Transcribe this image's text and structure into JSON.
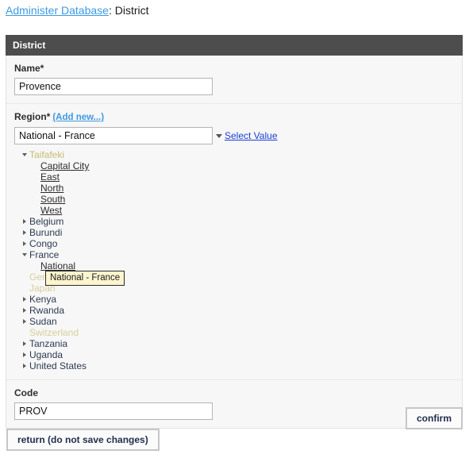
{
  "breadcrumb": {
    "link_label": "Administer Database",
    "separator": ": ",
    "current": "District"
  },
  "panel": {
    "title": "District"
  },
  "form": {
    "name_field": {
      "label": "Name*",
      "value": "Provence",
      "placeholder": ""
    },
    "region_field": {
      "label": "Region*",
      "add_new_label": "(Add new...)",
      "value": "National - France",
      "placeholder": "",
      "select_value_label": "Select Value",
      "dropdown_icon": "caret-down-icon"
    },
    "code_field": {
      "label": "Code",
      "value": "PROV",
      "placeholder": ""
    }
  },
  "tree": {
    "nodes": [
      {
        "label": "Taifafeki",
        "level": 0,
        "state": "expanded",
        "style": "accent"
      },
      {
        "label": "Capital City",
        "level": 1,
        "state": "leaf",
        "style": "leaf"
      },
      {
        "label": "East",
        "level": 1,
        "state": "leaf",
        "style": "leaf"
      },
      {
        "label": "North",
        "level": 1,
        "state": "leaf",
        "style": "leaf"
      },
      {
        "label": "South",
        "level": 1,
        "state": "leaf",
        "style": "leaf"
      },
      {
        "label": "West",
        "level": 1,
        "state": "leaf",
        "style": "leaf"
      },
      {
        "label": "Belgium",
        "level": 0,
        "state": "collapsed",
        "style": "branch"
      },
      {
        "label": "Burundi",
        "level": 0,
        "state": "collapsed",
        "style": "branch"
      },
      {
        "label": "Congo",
        "level": 0,
        "state": "collapsed",
        "style": "branch"
      },
      {
        "label": "France",
        "level": 0,
        "state": "expanded",
        "style": "branch"
      },
      {
        "label": "National",
        "level": 1,
        "state": "leaf",
        "style": "leaf"
      },
      {
        "label": "Germany",
        "level": 0,
        "state": "none",
        "style": "disabled"
      },
      {
        "label": "Japan",
        "level": 0,
        "state": "none",
        "style": "disabled"
      },
      {
        "label": "Kenya",
        "level": 0,
        "state": "collapsed",
        "style": "branch"
      },
      {
        "label": "Rwanda",
        "level": 0,
        "state": "collapsed",
        "style": "branch"
      },
      {
        "label": "Sudan",
        "level": 0,
        "state": "collapsed",
        "style": "branch"
      },
      {
        "label": "Switzerland",
        "level": 0,
        "state": "none",
        "style": "disabled"
      },
      {
        "label": "Tanzania",
        "level": 0,
        "state": "collapsed",
        "style": "branch"
      },
      {
        "label": "Uganda",
        "level": 0,
        "state": "collapsed",
        "style": "branch"
      },
      {
        "label": "United States",
        "level": 0,
        "state": "collapsed",
        "style": "branch"
      }
    ]
  },
  "tooltip": {
    "text": "National - France"
  },
  "buttons": {
    "confirm_label": "confirm",
    "return_label": "return (do not save changes)"
  },
  "colors": {
    "header_bar": "#4d4d4d",
    "panel_body": "#f7f7f7",
    "breadcrumb_link": "#3d9ae2",
    "select_value_link": "#1a3fd4",
    "tooltip_bg": "#fdf5ce",
    "disabled_node": "#d7cf9a",
    "button_text": "#1f2d4d"
  }
}
